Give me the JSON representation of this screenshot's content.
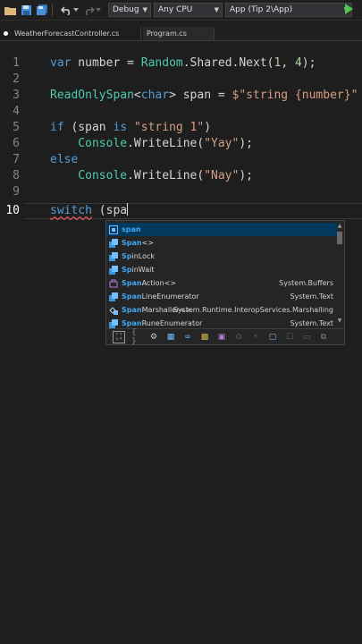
{
  "toolbar": {
    "config_select": "Debug",
    "platform_select": "Any CPU",
    "startup_select": "App (Tip 2\\App)"
  },
  "tabs": [
    {
      "label": "WeatherForecastController.cs"
    },
    {
      "label": "Program.cs"
    }
  ],
  "editor": {
    "line_numbers": [
      "1",
      "2",
      "3",
      "4",
      "5",
      "6",
      "7",
      "8",
      "9",
      "10"
    ],
    "lines": [
      [
        {
          "t": "var",
          "c": "kw"
        },
        {
          "t": " number = ",
          "c": "pl"
        },
        {
          "t": "Random",
          "c": "ty"
        },
        {
          "t": ".Shared.Next(",
          "c": "pl"
        },
        {
          "t": "1",
          "c": "nm"
        },
        {
          "t": ", ",
          "c": "pl"
        },
        {
          "t": "4",
          "c": "nm"
        },
        {
          "t": ");",
          "c": "pl"
        }
      ],
      [],
      [
        {
          "t": "ReadOnlySpan",
          "c": "ty"
        },
        {
          "t": "<",
          "c": "pl"
        },
        {
          "t": "char",
          "c": "kw"
        },
        {
          "t": "> span = ",
          "c": "pl"
        },
        {
          "t": "$\"string {number}\"",
          "c": "st"
        }
      ],
      [],
      [
        {
          "t": "if",
          "c": "kw"
        },
        {
          "t": " (span ",
          "c": "pl"
        },
        {
          "t": "is",
          "c": "kw"
        },
        {
          "t": " ",
          "c": "pl"
        },
        {
          "t": "\"string 1\"",
          "c": "st"
        },
        {
          "t": ")",
          "c": "pl"
        }
      ],
      [
        {
          "t": "    Console",
          "c": "ty"
        },
        {
          "t": ".WriteLine(",
          "c": "pl"
        },
        {
          "t": "\"Yay\"",
          "c": "st"
        },
        {
          "t": ");",
          "c": "pl"
        }
      ],
      [
        {
          "t": "else",
          "c": "kw"
        }
      ],
      [
        {
          "t": "    Console",
          "c": "ty"
        },
        {
          "t": ".WriteLine(",
          "c": "pl"
        },
        {
          "t": "\"Nay\"",
          "c": "st"
        },
        {
          "t": ");",
          "c": "pl"
        }
      ],
      [],
      [
        {
          "t": "switch",
          "c": "kw squig"
        },
        {
          "t": " (spa",
          "c": "pl"
        }
      ]
    ]
  },
  "completion": {
    "items": [
      {
        "bold": "span",
        "rest": "",
        "ns": "",
        "icon": "variable-icon",
        "selected": true
      },
      {
        "bold": "Span",
        "rest": "<>",
        "ns": "",
        "icon": "struct-icon"
      },
      {
        "bold": "Sp",
        "rest": "inLock",
        "ns": "",
        "icon": "struct-icon"
      },
      {
        "bold": "Sp",
        "rest": "inWait",
        "ns": "",
        "icon": "struct-icon"
      },
      {
        "bold": "Span",
        "rest": "Action<>",
        "ns": "System.Buffers",
        "icon": "delegate-icon"
      },
      {
        "bold": "Span",
        "rest": "LineEnumerator",
        "ns": "System.Text",
        "icon": "struct-icon"
      },
      {
        "bold": "Span",
        "rest": "Marshaller<>",
        "ns": "System.Runtime.InteropServices.Marshalling",
        "icon": "class-add-icon"
      },
      {
        "bold": "Span",
        "rest": "RuneEnumerator",
        "ns": "System.Text",
        "icon": "struct-icon"
      }
    ],
    "filters": [
      "expand-icon",
      "snippet-icon",
      "class-icon",
      "struct-icon",
      "enum-icon",
      "interface-icon",
      "delegate-icon",
      "module-icon",
      "event-icon",
      "local-icon",
      "keyword-icon",
      "namespace-icon",
      "extension-icon"
    ]
  },
  "colors": {
    "accent": "#04395e",
    "keyword": "#569cd6",
    "type": "#4ec9b0",
    "string": "#d69d85",
    "number": "#b5cea8"
  }
}
